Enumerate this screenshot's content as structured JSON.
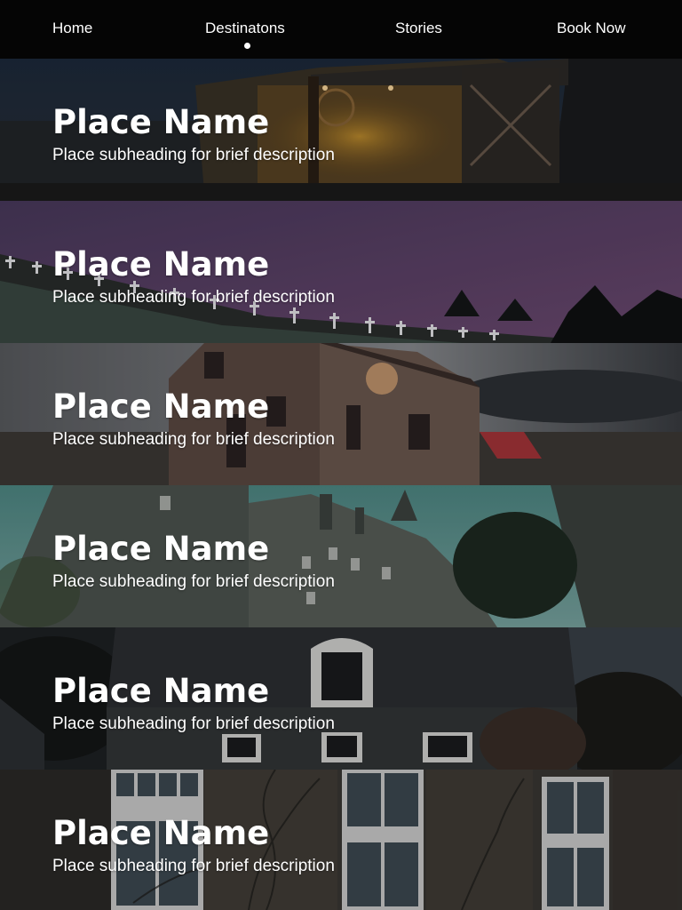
{
  "nav": {
    "items": [
      {
        "label": "Home",
        "active": false
      },
      {
        "label": "Destinatons",
        "active": true
      },
      {
        "label": "Stories",
        "active": false
      },
      {
        "label": "Book Now",
        "active": false
      }
    ]
  },
  "places": [
    {
      "title": "Place Name",
      "subtitle": "Place subheading for brief description",
      "image": "night farmhouse with lit porch"
    },
    {
      "title": "Place Name",
      "subtitle": "Place subheading for brief description",
      "image": "graveyard crosses under purple sky"
    },
    {
      "title": "Place Name",
      "subtitle": "Place subheading for brief description",
      "image": "abandoned wooden house"
    },
    {
      "title": "Place Name",
      "subtitle": "Place subheading for brief description",
      "image": "gothic stone castle"
    },
    {
      "title": "Place Name",
      "subtitle": "Place subheading for brief description",
      "image": "dark house with dormer window"
    },
    {
      "title": "Place Name",
      "subtitle": "Place subheading for brief description",
      "image": "old brick manor with white windows"
    }
  ],
  "colors": {
    "nav_bg": "#050505",
    "text": "#ffffff"
  }
}
